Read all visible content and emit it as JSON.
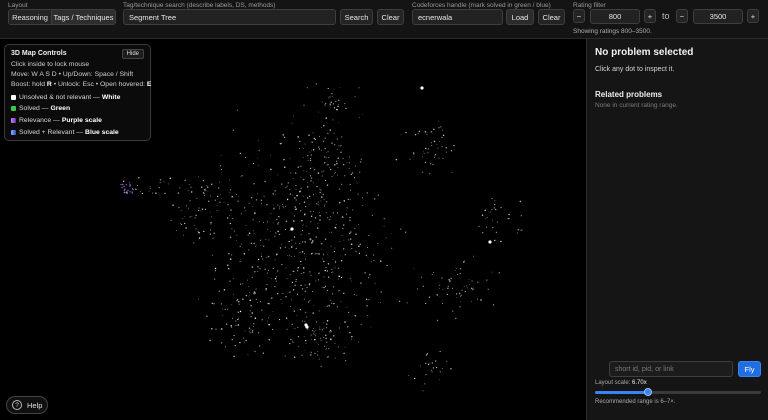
{
  "topbar": {
    "layout": {
      "label": "Layout",
      "options": [
        "Reasoning",
        "Tags / Techniques"
      ],
      "active": 1
    },
    "tag_search": {
      "label": "Tag/technique search (describe labels, DS, methods)",
      "value": "Segment Tree",
      "search_label": "Search",
      "clear_label": "Clear"
    },
    "handle": {
      "label": "Codeforces handle (mark solved in green / blue)",
      "value": "ecnerwala",
      "load_label": "Load",
      "clear_label": "Clear"
    },
    "rating": {
      "label": "Rating filter",
      "min": "800",
      "max": "3500",
      "to_label": "to",
      "minus": "−",
      "plus": "+",
      "status": "Showing ratings 800–3500."
    }
  },
  "map_controls": {
    "title": "3D Map Controls",
    "hide_label": "Hide",
    "line1": "Click inside to lock mouse",
    "line2": "Move: W A S D • Up/Down: Space / Shift",
    "line3_pre": "Boost: hold ",
    "line3_key1": "R",
    "line3_mid": " • Unlock: Esc • Open hovered: ",
    "line3_key2": "E",
    "legend": [
      {
        "text": "Unsolved & not relevant — ",
        "bold": "White",
        "color": "#ffffff"
      },
      {
        "text": "Solved — ",
        "bold": "Green",
        "color": "#37c94a"
      },
      {
        "text": "Relevance — ",
        "bold": "Purple scale",
        "color": "#9b59d6"
      },
      {
        "text": "Solved + Relevant — ",
        "bold": "Blue scale",
        "color": "#5b7fe0"
      }
    ]
  },
  "help": {
    "icon": "question-icon",
    "glyph": "?",
    "label": "Help"
  },
  "panel": {
    "title": "No problem selected",
    "hint": "Click any dot to inspect it.",
    "related_title": "Related problems",
    "related_empty": "None in current rating range.",
    "fly_placeholder": "short id, pid, or link",
    "fly_label": "Fly",
    "scale_label": "Layout scale:",
    "scale_value": "6.70x",
    "scale_fraction": 0.32,
    "recommended": "Recommended range is 6–7×."
  },
  "colors": {
    "accent": "#1f6fe0",
    "solved": "#37c94a",
    "relevant": "#9b59d6",
    "solved_relevant": "#5b7fe0"
  }
}
